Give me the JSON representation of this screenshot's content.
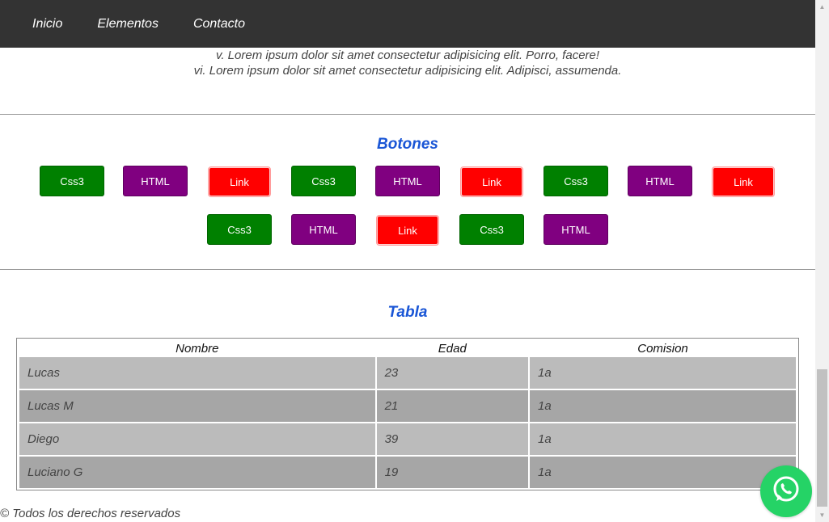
{
  "nav": {
    "items": [
      {
        "label": "Inicio"
      },
      {
        "label": "Elementos"
      },
      {
        "label": "Contacto"
      }
    ]
  },
  "lorem": {
    "line5": "v. Lorem ipsum dolor sit amet consectetur adipisicing elit. Porro, facere!",
    "line6": "vi. Lorem ipsum dolor sit amet consectetur adipisicing elit. Adipisci, assumenda."
  },
  "botones": {
    "title": "Botones",
    "buttons": [
      {
        "label": "Css3"
      },
      {
        "label": "HTML"
      },
      {
        "label": "Link"
      },
      {
        "label": "Css3"
      },
      {
        "label": "HTML"
      },
      {
        "label": "Link"
      },
      {
        "label": "Css3"
      },
      {
        "label": "HTML"
      },
      {
        "label": "Link"
      },
      {
        "label": "Css3"
      },
      {
        "label": "HTML"
      },
      {
        "label": "Link"
      },
      {
        "label": "Css3"
      },
      {
        "label": "HTML"
      }
    ]
  },
  "tabla": {
    "title": "Tabla",
    "headers": [
      "Nombre",
      "Edad",
      "Comision"
    ],
    "rows": [
      [
        "Lucas",
        "23",
        "1a"
      ],
      [
        "Lucas M",
        "21",
        "1a"
      ],
      [
        "Diego",
        "39",
        "1a"
      ],
      [
        "Luciano G",
        "19",
        "1a"
      ]
    ]
  },
  "footer": {
    "text": "© Todos los derechos reservados"
  },
  "colors": {
    "navbar": "#333333",
    "title_blue": "#1a56d6",
    "css3_green": "#008000",
    "html_purple": "#800080",
    "link_red": "#ff0000",
    "whatsapp_green": "#25d366"
  },
  "icons": {
    "floating": "whatsapp-icon"
  }
}
